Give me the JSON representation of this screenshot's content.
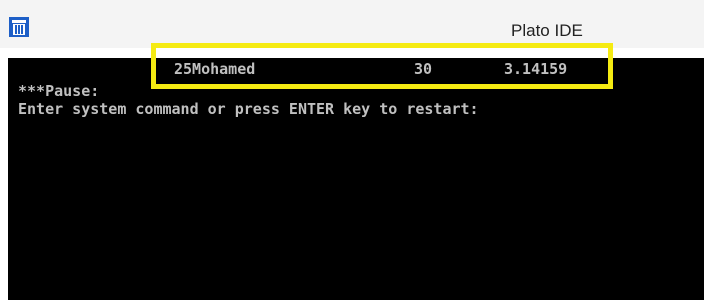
{
  "window": {
    "title": "Plato IDE",
    "icon": "recycle-bin-icon"
  },
  "console": {
    "output_row": {
      "name": "25Mohamed",
      "age": "30",
      "pi": "3.14159"
    },
    "pause_line": "***Pause:",
    "prompt_line": "Enter system command or press ENTER key to restart:"
  },
  "colors": {
    "console_background": "#000000",
    "console_text": "#c0c0c0",
    "highlight": "#f5eb12",
    "icon_blue": "#1e5fc7"
  }
}
